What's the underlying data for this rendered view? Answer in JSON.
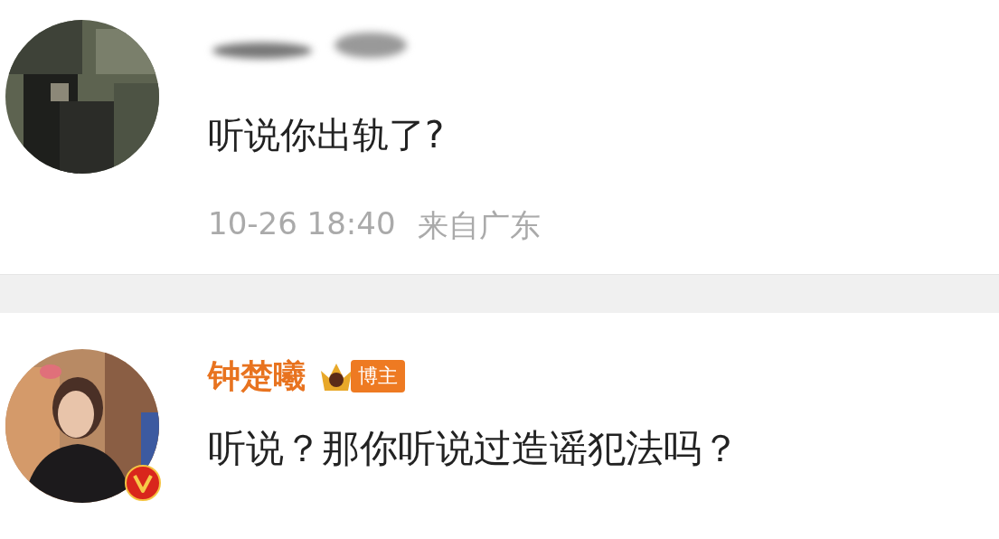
{
  "comments": [
    {
      "author_blurred": true,
      "text": "听说你出轨了?",
      "time": "10-26 18:40",
      "location": "来自广东"
    },
    {
      "author": "钟楚曦",
      "badge": "博主",
      "verified": true,
      "text": "听说？那你听说过造谣犯法吗？"
    }
  ]
}
